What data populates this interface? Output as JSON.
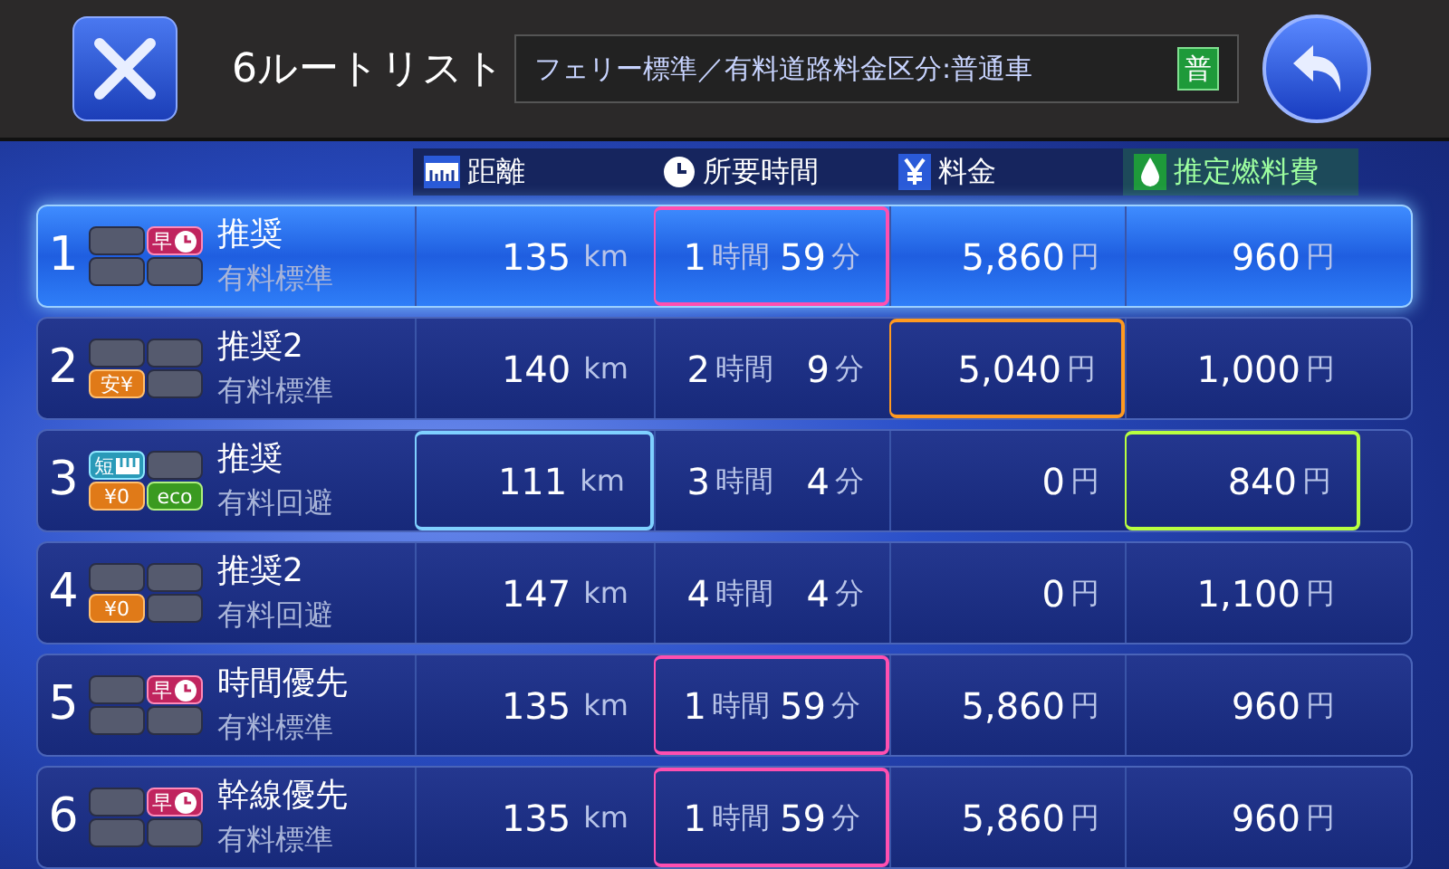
{
  "header": {
    "title": "6ルートリスト",
    "conditions": "フェリー標準／有料道路料金区分:普通車",
    "vehicle_badge": "普"
  },
  "columns": [
    {
      "kind": "distance",
      "label": "距離"
    },
    {
      "kind": "time",
      "label": "所要時間"
    },
    {
      "kind": "fee",
      "label": "料金"
    },
    {
      "kind": "fuel",
      "label": "推定燃料費"
    }
  ],
  "routes": [
    {
      "number": "1",
      "selected": true,
      "badges": [
        {
          "kind": "empty"
        },
        {
          "kind": "fast",
          "label": "早"
        },
        {
          "kind": "empty"
        },
        {
          "kind": "empty"
        }
      ],
      "title": "推奨",
      "subtitle": "有料標準",
      "distance": {
        "value": "135",
        "unit": "km",
        "best": false
      },
      "time": {
        "hours": "1",
        "hours_unit": "時間",
        "minutes": "59",
        "minutes_unit": "分",
        "best": true
      },
      "fee": {
        "value": "5,860",
        "unit": "円",
        "best": false
      },
      "fuel": {
        "value": "960",
        "unit": "円",
        "best": false
      }
    },
    {
      "number": "2",
      "selected": false,
      "badges": [
        {
          "kind": "empty"
        },
        {
          "kind": "empty"
        },
        {
          "kind": "cheap",
          "label": "安¥"
        },
        {
          "kind": "empty"
        }
      ],
      "title": "推奨2",
      "subtitle": "有料標準",
      "distance": {
        "value": "140",
        "unit": "km",
        "best": false
      },
      "time": {
        "hours": "2",
        "hours_unit": "時間",
        "minutes": "9",
        "minutes_unit": "分",
        "best": false
      },
      "fee": {
        "value": "5,040",
        "unit": "円",
        "best": true
      },
      "fuel": {
        "value": "1,000",
        "unit": "円",
        "best": false
      }
    },
    {
      "number": "3",
      "selected": false,
      "badges": [
        {
          "kind": "short",
          "label": "短"
        },
        {
          "kind": "empty"
        },
        {
          "kind": "free",
          "label": "¥0"
        },
        {
          "kind": "eco",
          "label": "eco"
        }
      ],
      "title": "推奨",
      "subtitle": "有料回避",
      "distance": {
        "value": "111",
        "unit": "km",
        "best": true
      },
      "time": {
        "hours": "3",
        "hours_unit": "時間",
        "minutes": "4",
        "minutes_unit": "分",
        "best": false
      },
      "fee": {
        "value": "0",
        "unit": "円",
        "best": false
      },
      "fuel": {
        "value": "840",
        "unit": "円",
        "best": true
      }
    },
    {
      "number": "4",
      "selected": false,
      "badges": [
        {
          "kind": "empty"
        },
        {
          "kind": "empty"
        },
        {
          "kind": "free",
          "label": "¥0"
        },
        {
          "kind": "empty"
        }
      ],
      "title": "推奨2",
      "subtitle": "有料回避",
      "distance": {
        "value": "147",
        "unit": "km",
        "best": false
      },
      "time": {
        "hours": "4",
        "hours_unit": "時間",
        "minutes": "4",
        "minutes_unit": "分",
        "best": false
      },
      "fee": {
        "value": "0",
        "unit": "円",
        "best": false
      },
      "fuel": {
        "value": "1,100",
        "unit": "円",
        "best": false
      }
    },
    {
      "number": "5",
      "selected": false,
      "badges": [
        {
          "kind": "empty"
        },
        {
          "kind": "fast",
          "label": "早"
        },
        {
          "kind": "empty"
        },
        {
          "kind": "empty"
        }
      ],
      "title": "時間優先",
      "subtitle": "有料標準",
      "distance": {
        "value": "135",
        "unit": "km",
        "best": false
      },
      "time": {
        "hours": "1",
        "hours_unit": "時間",
        "minutes": "59",
        "minutes_unit": "分",
        "best": true
      },
      "fee": {
        "value": "5,860",
        "unit": "円",
        "best": false
      },
      "fuel": {
        "value": "960",
        "unit": "円",
        "best": false
      }
    },
    {
      "number": "6",
      "selected": false,
      "badges": [
        {
          "kind": "empty"
        },
        {
          "kind": "fast",
          "label": "早"
        },
        {
          "kind": "empty"
        },
        {
          "kind": "empty"
        }
      ],
      "title": "幹線優先",
      "subtitle": "有料標準",
      "distance": {
        "value": "135",
        "unit": "km",
        "best": false
      },
      "time": {
        "hours": "1",
        "hours_unit": "時間",
        "minutes": "59",
        "minutes_unit": "分",
        "best": true
      },
      "fee": {
        "value": "5,860",
        "unit": "円",
        "best": false
      },
      "fuel": {
        "value": "960",
        "unit": "円",
        "best": false
      }
    }
  ]
}
